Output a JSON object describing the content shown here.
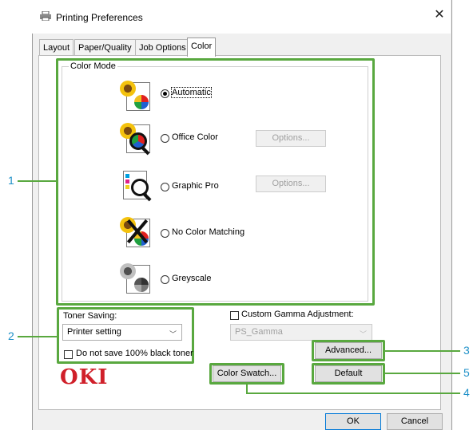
{
  "window": {
    "title": "Printing Preferences",
    "close_glyph": "✕"
  },
  "tabs": [
    {
      "label": "Layout",
      "active": false
    },
    {
      "label": "Paper/Quality",
      "active": false
    },
    {
      "label": "Job Options",
      "active": false
    },
    {
      "label": "Color",
      "active": true
    }
  ],
  "color_mode": {
    "legend": "Color Mode",
    "options": [
      {
        "label": "Automatic",
        "selected": true,
        "icon": "color-page-icon"
      },
      {
        "label": "Office Color",
        "selected": false,
        "icon": "color-magnifier-icon",
        "options_button": "Options..."
      },
      {
        "label": "Graphic Pro",
        "selected": false,
        "icon": "cmyk-magnifier-icon",
        "options_button": "Options..."
      },
      {
        "label": "No Color Matching",
        "selected": false,
        "icon": "no-matching-icon"
      },
      {
        "label": "Greyscale",
        "selected": false,
        "icon": "greyscale-page-icon"
      }
    ]
  },
  "toner": {
    "label": "Toner Saving:",
    "value": "Printer setting",
    "checkbox_label": "Do not save 100% black toner",
    "checked": false
  },
  "gamma": {
    "checkbox_label": "Custom Gamma Adjustment:",
    "checked": false,
    "value": "PS_Gamma"
  },
  "buttons": {
    "advanced": "Advanced...",
    "default": "Default",
    "color_swatch": "Color Swatch...",
    "ok": "OK",
    "cancel": "Cancel"
  },
  "brand": {
    "logo": "OKI",
    "color": "#d0202a"
  },
  "callouts": [
    "1",
    "2",
    "3",
    "4",
    "5"
  ],
  "colors": {
    "highlight": "#59a83f",
    "callout_text": "#1e90c8"
  }
}
